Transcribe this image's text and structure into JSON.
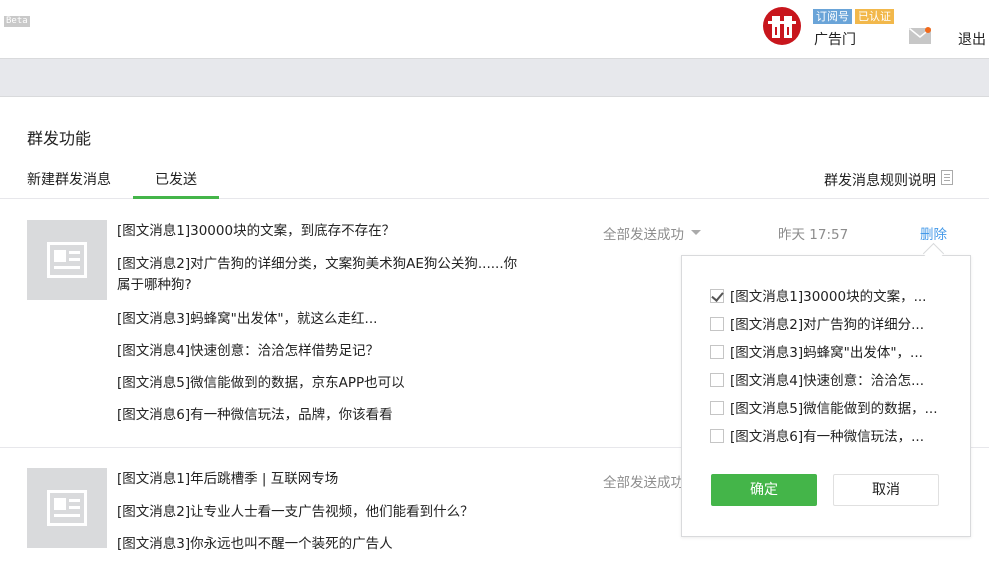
{
  "header": {
    "beta_label": "Beta",
    "account": {
      "tag_subscription": "订阅号",
      "tag_verified": "已认证",
      "name": "广告门"
    },
    "logout_label": "退出"
  },
  "page": {
    "title": "群发功能",
    "tabs": [
      {
        "label": "新建群发消息",
        "active": false
      },
      {
        "label": "已发送",
        "active": true
      }
    ],
    "rules_link": "群发消息规则说明"
  },
  "groups": [
    {
      "messages": [
        "[图文消息1]30000块的文案，到底存不存在？",
        "[图文消息2]对广告狗的详细分类，文案狗美术狗AE狗公关狗......你",
        "属于哪种狗?",
        "[图文消息3]蚂蜂窝\"出发体\"，就这么走红...",
        "[图文消息4]快速创意：洽洽怎样借势足记？",
        "[图文消息5]微信能做到的数据，京东APP也可以",
        "[图文消息6]有一种微信玩法，品牌，你该看看"
      ],
      "status": "全部发送成功",
      "time": "昨天 17:57",
      "delete_label": "删除"
    },
    {
      "messages": [
        "[图文消息1]年后跳槽季 | 互联网专场",
        "[图文消息2]让专业人士看一支广告视频，他们能看到什么？",
        "[图文消息3]你永远也叫不醒一个装死的广告人"
      ],
      "status": "全部发送成功"
    }
  ],
  "popover": {
    "options": [
      {
        "label": "[图文消息1]30000块的文案，...",
        "checked": true
      },
      {
        "label": "[图文消息2]对广告狗的详细分...",
        "checked": false
      },
      {
        "label": "[图文消息3]蚂蜂窝\"出发体\"，...",
        "checked": false
      },
      {
        "label": "[图文消息4]快速创意：洽洽怎...",
        "checked": false
      },
      {
        "label": "[图文消息5]微信能做到的数据，...",
        "checked": false
      },
      {
        "label": "[图文消息6]有一种微信玩法，...",
        "checked": false
      }
    ],
    "confirm_label": "确定",
    "cancel_label": "取消"
  },
  "colors": {
    "accent_green": "#44b549",
    "link_blue": "#459ae9",
    "notification_orange": "#f26a1b"
  }
}
